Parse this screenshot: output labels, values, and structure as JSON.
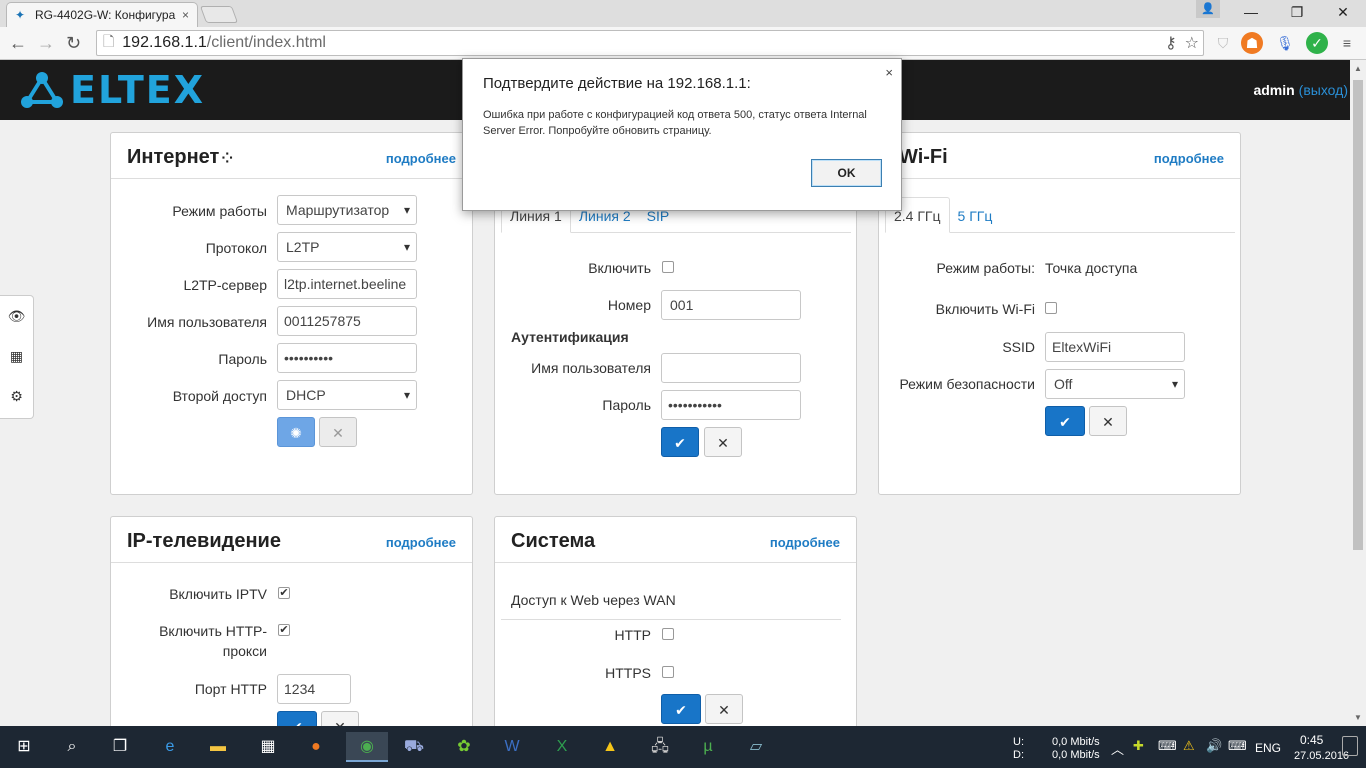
{
  "browser": {
    "tab_title": "RG-4402G-W: Конфигура",
    "tab_close": "×",
    "url_host": "192.168.1.1",
    "url_path": "/client/index.html",
    "window_min": "—",
    "window_restore": "❐",
    "window_close": "✕"
  },
  "header": {
    "logo_text": "ELTEX",
    "user": "admin",
    "logout": "(выход)"
  },
  "internet": {
    "title": "Интернет",
    "more": "подробнее",
    "mode_label": "Режим работы",
    "mode_value": "Маршрутизатор",
    "protocol_label": "Протокол",
    "protocol_value": "L2TP",
    "server_label": "L2TP-сервер",
    "server_value": "l2tp.internet.beeline",
    "user_label": "Имя пользователя",
    "user_value": "0011257875",
    "password_label": "Пароль",
    "password_value": "••••••••••",
    "second_label": "Второй доступ",
    "second_value": "DHCP"
  },
  "voip": {
    "tab1": "Линия 1",
    "tab2": "Линия 2",
    "tab3": "SIP",
    "enable_label": "Включить",
    "number_label": "Номер",
    "number_value": "001",
    "auth_title": "Аутентификация",
    "user_label": "Имя пользователя",
    "password_label": "Пароль",
    "password_value": "•••••••••••"
  },
  "wifi": {
    "title": "Wi-Fi",
    "more": "подробнее",
    "tab1": "2.4 ГГц",
    "tab2": "5 ГГц",
    "mode_label": "Режим работы:",
    "mode_value": "Точка доступа",
    "enable_label": "Включить Wi-Fi",
    "ssid_label": "SSID",
    "ssid_value": "EltexWiFi",
    "security_label": "Режим безопасности",
    "security_value": "Off"
  },
  "iptv": {
    "title": "IP-телевидение",
    "more": "подробнее",
    "enable_label": "Включить IPTV",
    "proxy_label_1": "Включить HTTP-",
    "proxy_label_2": "прокси",
    "port_label": "Порт HTTP",
    "port_value": "1234"
  },
  "system": {
    "title": "Система",
    "more": "подробнее",
    "access_title": "Доступ к Web через WAN",
    "http_label": "HTTP",
    "https_label": "HTTPS"
  },
  "dialog": {
    "title": "Подтвердите действие на 192.168.1.1:",
    "message": "Ошибка при работе с конфигурацией код ответа 500, статус ответа Internal Server Error. Попробуйте обновить страницу.",
    "ok": "OK",
    "close": "×"
  },
  "taskbar": {
    "net_u_label": "U:",
    "net_d_label": "D:",
    "net_u_value": "0,0 Mbit/s",
    "net_d_value": "0,0 Mbit/s",
    "lang": "ENG",
    "time": "0:45",
    "date": "27.05.2016"
  }
}
